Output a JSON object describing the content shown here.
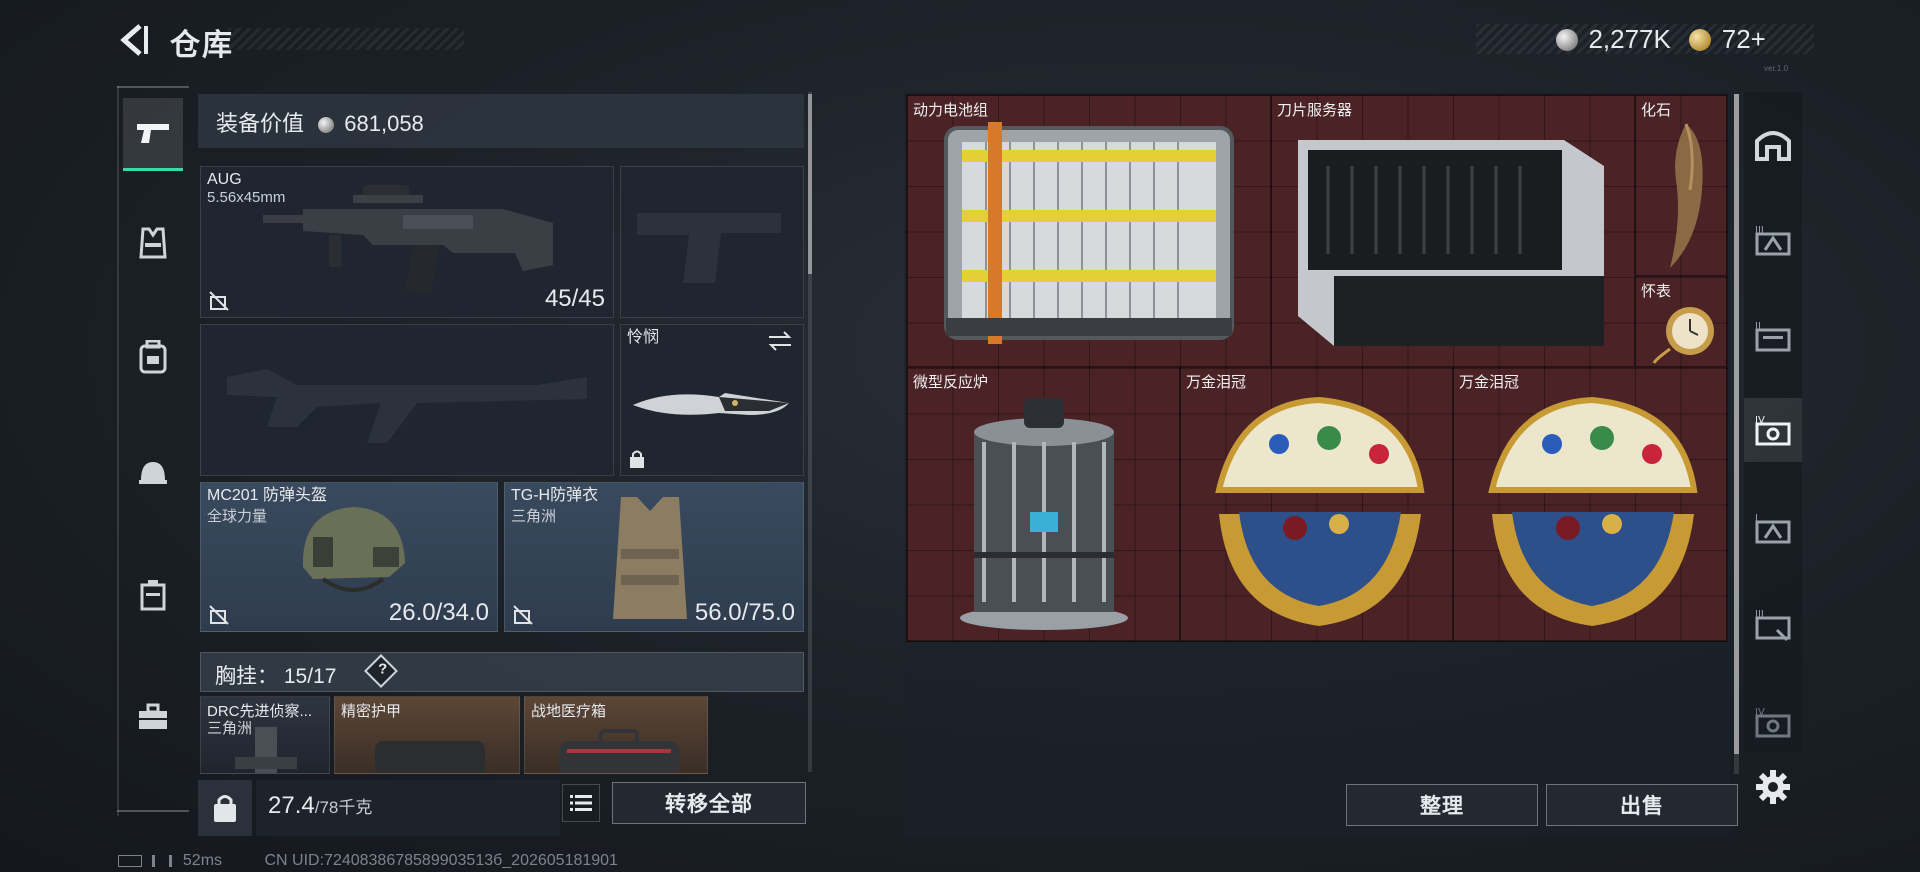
{
  "header": {
    "title": "仓库",
    "currency_silver": "2,277K",
    "currency_gold": "72+",
    "version": "ver.1.0"
  },
  "left_rail": {
    "items": [
      {
        "icon": "pistol-icon",
        "active": true
      },
      {
        "icon": "vest-icon"
      },
      {
        "icon": "backpack-icon"
      },
      {
        "icon": "helmet-icon"
      },
      {
        "icon": "chest-rig-icon"
      },
      {
        "icon": "toolbox-icon"
      }
    ]
  },
  "equipment": {
    "value_label": "装备价值",
    "value": "681,058",
    "primary_weapon": {
      "name": "AUG",
      "ammo_type": "5.56x45mm",
      "ammo": "45/45"
    },
    "knife": {
      "name": "怜悯"
    },
    "helmet": {
      "name": "MC201 防弹头盔",
      "brand": "全球力量",
      "durability": "26.0/34.0"
    },
    "armor": {
      "name": "TG-H防弹衣",
      "brand": "三角洲",
      "durability": "56.0/75.0"
    },
    "chest_rig": {
      "label": "胸挂：",
      "capacity": "15/17",
      "help": "?"
    },
    "chest_items": [
      {
        "name": "DRC先进侦察...",
        "brand": "三角洲"
      },
      {
        "name": "精密护甲",
        "brand": ""
      },
      {
        "name": "战地医疗箱",
        "brand": ""
      }
    ]
  },
  "bottom_bar": {
    "weight": "27.4",
    "weight_max": "/78千克",
    "transfer_all": "转移全部"
  },
  "status": {
    "ping": "52ms",
    "uid": "CN UID:7240838678589903513б_202605181901"
  },
  "storage": {
    "items": [
      {
        "name": "动力电池组",
        "color": "#4b2327"
      },
      {
        "name": "刀片服务器",
        "color": "#4b2327"
      },
      {
        "name": "化石",
        "color": "#4b2327"
      },
      {
        "name": "怀表",
        "color": "#4b2327"
      },
      {
        "name": "微型反应炉",
        "color": "#4b2327"
      },
      {
        "name": "万金泪冠",
        "color": "#4b2327"
      },
      {
        "name": "万金泪冠",
        "color": "#4b2327"
      }
    ],
    "sort_label": "整理",
    "sell_label": "出售"
  },
  "right_rail": {
    "items": [
      "home-icon",
      "vault-3-icon",
      "vault-2-icon",
      "vault-4-icon",
      "vault-1-icon",
      "vault-3b-icon",
      "vault-4b-icon"
    ],
    "active_index": 3
  },
  "colors": {
    "accent": "#3fd7a6",
    "storage_bg": "#4b2327"
  }
}
